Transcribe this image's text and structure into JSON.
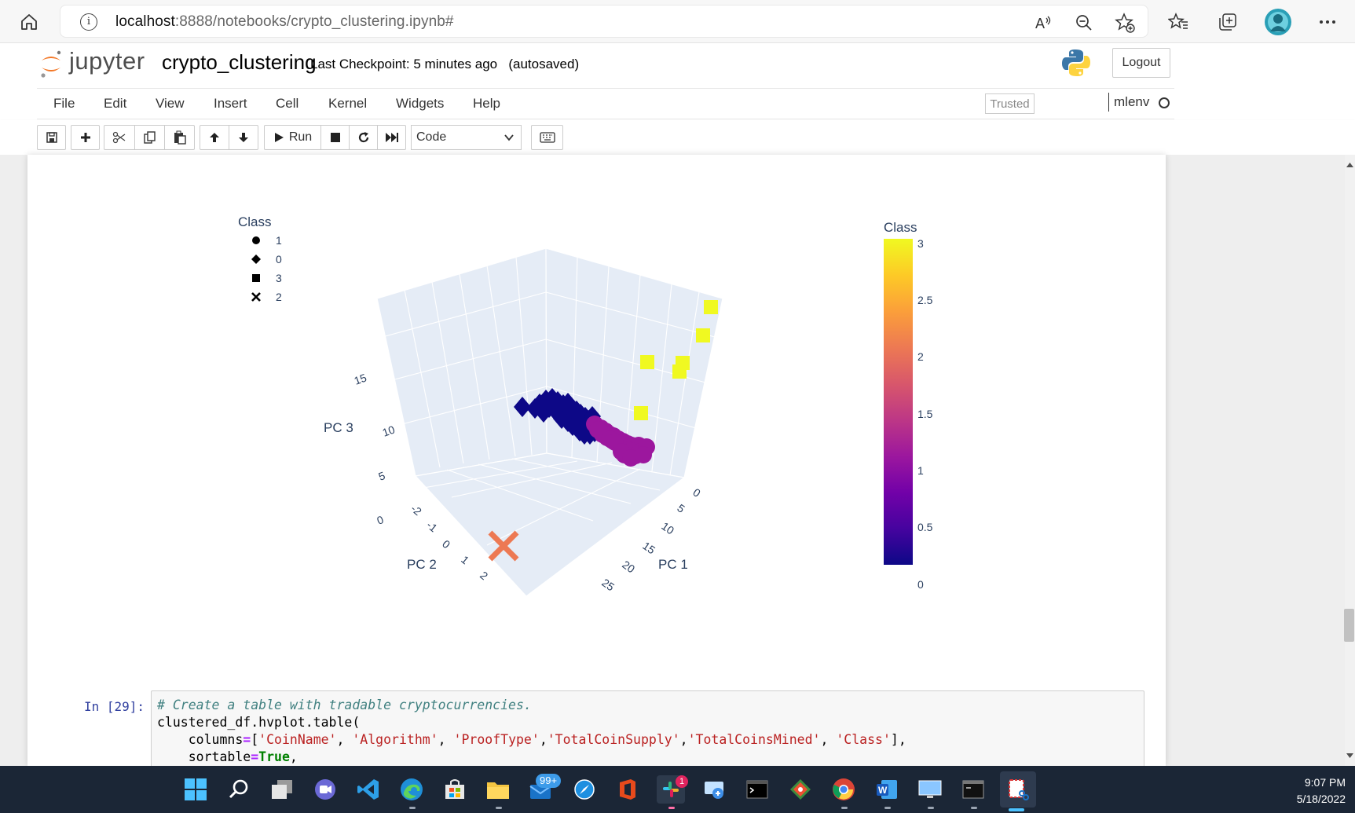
{
  "browser": {
    "url_host": "localhost",
    "url_path": ":8888/notebooks/crypto_clustering.ipynb#"
  },
  "jupyter": {
    "logo_text": "jupyter",
    "notebook_name": "crypto_clustering",
    "checkpoint": "Last Checkpoint: 5 minutes ago",
    "autosave": "(autosaved)",
    "logout_label": "Logout",
    "trusted_label": "Trusted",
    "kernel_name": "mlenv"
  },
  "menu": [
    "File",
    "Edit",
    "View",
    "Insert",
    "Cell",
    "Kernel",
    "Widgets",
    "Help"
  ],
  "toolbar": {
    "run_label": "Run",
    "cell_type": "Code"
  },
  "chart_data": {
    "type": "scatter3d",
    "title": "",
    "axes": {
      "x": {
        "label": "PC 1",
        "ticks": [
          "0",
          "5",
          "10",
          "15",
          "20",
          "25"
        ]
      },
      "y": {
        "label": "PC 2",
        "ticks": [
          "-2",
          "-1",
          "0",
          "1",
          "2"
        ]
      },
      "z": {
        "label": "PC 3",
        "ticks": [
          "0",
          "5",
          "10",
          "15"
        ]
      }
    },
    "legend": {
      "title": "Class",
      "placement": "top-left",
      "entries": [
        {
          "name": "1",
          "symbol": "circle"
        },
        {
          "name": "0",
          "symbol": "diamond"
        },
        {
          "name": "3",
          "symbol": "square"
        },
        {
          "name": "2",
          "symbol": "x"
        }
      ]
    },
    "colorbar": {
      "title": "Class",
      "range": [
        0,
        3
      ],
      "ticks": [
        "3",
        "2.5",
        "2",
        "1.5",
        "1",
        "0.5",
        "0"
      ],
      "colors": [
        "#0d0887",
        "#46039f",
        "#7201a8",
        "#9c179e",
        "#bd3786",
        "#d8576b",
        "#ed7953",
        "#fb9f3a",
        "#fdca26",
        "#f0f921"
      ]
    },
    "series": [
      {
        "name": "0",
        "symbol": "diamond",
        "color": "#0d0887",
        "points": 40
      },
      {
        "name": "1",
        "symbol": "circle",
        "color": "#9c179e",
        "points": 30
      },
      {
        "name": "3",
        "symbol": "square",
        "color": "#f0f921",
        "points": 6
      },
      {
        "name": "2",
        "symbol": "x",
        "color": "#ed7953",
        "points": 1
      }
    ]
  },
  "code_cell": {
    "prompt": "In [29]:",
    "comment": "# Create a table with tradable cryptocurrencies.",
    "line2": "clustered_df.hvplot.table(",
    "line3_prefix": "    columns",
    "line3_eq": "=",
    "line3_open": "[",
    "line3_strings": [
      "'CoinName'",
      "'Algorithm'",
      "'ProofType'",
      "'TotalCoinSupply'",
      "'TotalCoinsMined'",
      "'Class'"
    ],
    "line3_close": "],",
    "line4_prefix": "    sortable",
    "line4_eq": "=",
    "line4_value": "True",
    "line4_suffix": ","
  },
  "taskbar": {
    "mail_badge": "99+",
    "slack_badge": "1",
    "time": "9:07 PM",
    "date": "5/18/2022"
  }
}
